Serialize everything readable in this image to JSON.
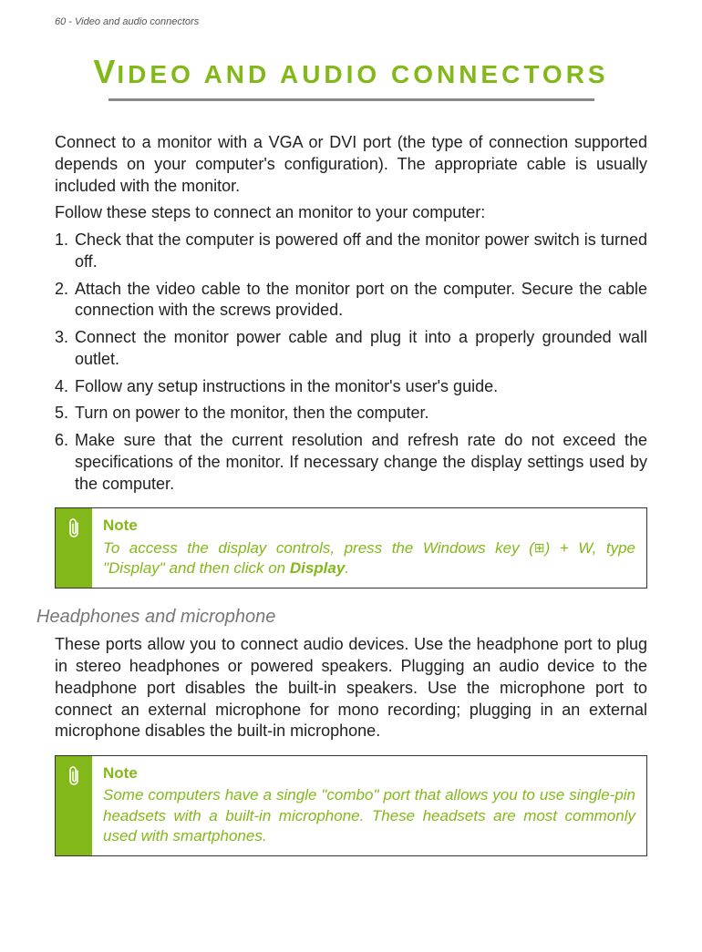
{
  "header": "60 - Video and audio connectors",
  "title_big": "V",
  "title_rest": "IDEO AND AUDIO CONNECTORS",
  "intro1": "Connect to a monitor with a VGA or DVI port (the type of connection supported depends on your computer's configuration). The appropriate cable is usually included with the monitor.",
  "intro2": "Follow these steps to connect an monitor to your computer:",
  "steps": [
    "Check that the computer is powered off and the monitor power switch is turned off.",
    "Attach the video cable to the monitor port on the computer. Secure the cable connection with the screws provided.",
    "Connect the monitor power cable and plug it into a properly grounded wall outlet.",
    "Follow any setup instructions in the monitor's user's guide.",
    "Turn on power to the monitor, then the computer.",
    "Make sure that the current resolution and refresh rate do not exceed the specifications of the monitor. If necessary change the display settings used by the computer."
  ],
  "note1": {
    "label": "Note",
    "pre": "To access the display controls, press the Windows key (",
    "win": "⊞",
    "post1": ") + W, type \"Display\" and then click on ",
    "bold": "Display",
    "post2": "."
  },
  "subhead": "Headphones and microphone",
  "hp_para": "These ports allow you to connect audio devices. Use the headphone port to plug in stereo headphones or powered speakers. Plugging an audio device to the headphone port disables the built-in speakers. Use the microphone port to connect an external microphone for mono recording; plugging in an external microphone disables the built-in microphone.",
  "note2": {
    "label": "Note",
    "text": "Some computers have a single \"combo\" port that allows you to use single-pin headsets with a built-in microphone. These headsets are most commonly used with smartphones."
  }
}
